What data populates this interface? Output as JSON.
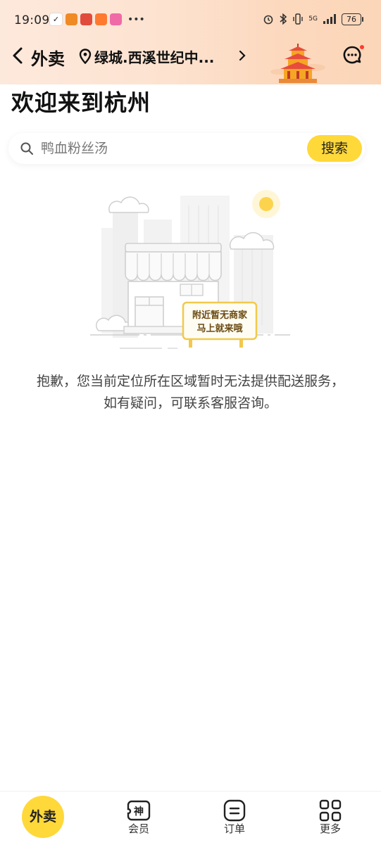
{
  "status_bar": {
    "time": "19:09",
    "battery": "76",
    "network": "5G"
  },
  "nav": {
    "title": "外卖",
    "location": "绿城.西溪世纪中..."
  },
  "welcome": "欢迎来到杭州",
  "search": {
    "placeholder": "鸭血粉丝汤",
    "button": "搜索"
  },
  "illustration": {
    "sign_line1": "附近暂无商家",
    "sign_line2": "马上就来哦"
  },
  "empty": {
    "line1": "抱歉，您当前定位所在区域暂时无法提供配送服务，",
    "line2": "如有疑问，可联系客服咨询。"
  },
  "tabs": {
    "home": "外卖",
    "member_icon_text": "神",
    "member": "会员",
    "orders": "订单",
    "more": "更多"
  },
  "colors": {
    "accent_yellow": "#ffd83a",
    "header_peach": "#fde2cf",
    "sign_border": "#f2c94c"
  }
}
